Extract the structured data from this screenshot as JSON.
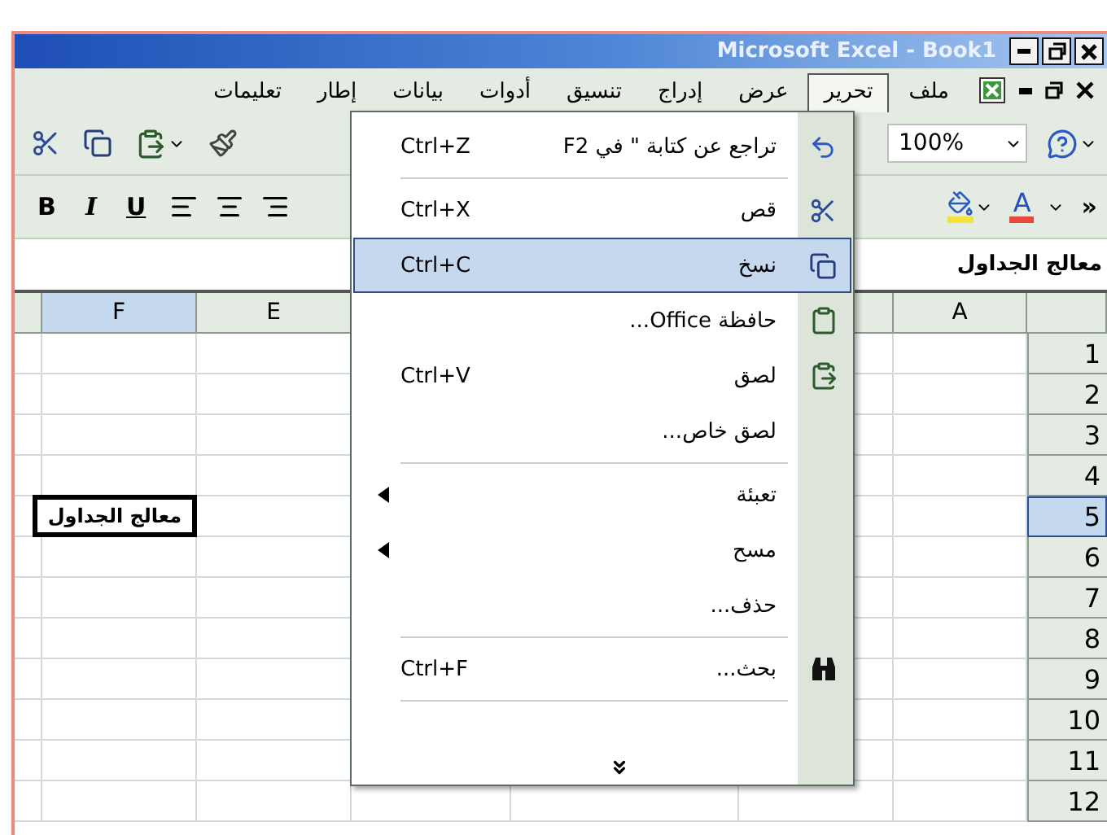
{
  "window": {
    "title": "Microsoft Excel - Book1"
  },
  "menu_bar": {
    "items": [
      {
        "label": "ملف",
        "selected": false
      },
      {
        "label": "تحرير",
        "selected": true
      },
      {
        "label": "عرض",
        "selected": false
      },
      {
        "label": "إدراج",
        "selected": false
      },
      {
        "label": "تنسيق",
        "selected": false
      },
      {
        "label": "أدوات",
        "selected": false
      },
      {
        "label": "بيانات",
        "selected": false
      },
      {
        "label": "إطار",
        "selected": false
      },
      {
        "label": "تعليمات",
        "selected": false
      }
    ]
  },
  "standard_toolbar": {
    "zoom": "100%"
  },
  "formatting_toolbar": {
    "format_buttons": [
      {
        "kind": "underline",
        "label": "U"
      },
      {
        "kind": "italic",
        "label": "I"
      },
      {
        "kind": "bold",
        "label": "B"
      }
    ],
    "font_color": "A",
    "overflow": "»"
  },
  "formula_bar": {
    "value": "معالج الجداول"
  },
  "sheet": {
    "columns": [
      {
        "label": "A",
        "selected": false
      },
      {
        "label": "E",
        "selected": false
      },
      {
        "label": "F",
        "selected": true
      }
    ],
    "rows": [
      {
        "number": "1",
        "selected": false
      },
      {
        "number": "2",
        "selected": false
      },
      {
        "number": "3",
        "selected": false
      },
      {
        "number": "4",
        "selected": false
      },
      {
        "number": "5",
        "selected": true,
        "column_f": "معالج الجداول"
      },
      {
        "number": "6",
        "selected": false
      },
      {
        "number": "7",
        "selected": false
      },
      {
        "number": "8",
        "selected": false
      },
      {
        "number": "9",
        "selected": false
      },
      {
        "number": "10",
        "selected": false
      },
      {
        "number": "11",
        "selected": false
      },
      {
        "number": "12",
        "selected": false
      }
    ]
  },
  "edit_menu": {
    "groups": [
      [
        {
          "kind": "undo",
          "label": "تراجع عن كتابة \" في F2",
          "shortcut": "Ctrl+Z",
          "selected": false,
          "submenu": false
        }
      ],
      [
        {
          "kind": "cut",
          "label": "قص",
          "shortcut": "Ctrl+X",
          "selected": false,
          "submenu": false
        },
        {
          "kind": "copy",
          "label": "نسخ",
          "shortcut": "Ctrl+C",
          "selected": true,
          "submenu": false
        },
        {
          "kind": "clipboard",
          "label": "حافظة Office...",
          "selected": false,
          "submenu": false
        },
        {
          "kind": "paste",
          "label": "لصق",
          "shortcut": "Ctrl+V",
          "selected": false,
          "submenu": false
        },
        {
          "kind": "plain",
          "label": "لصق خاص...",
          "selected": false,
          "submenu": false
        }
      ],
      [
        {
          "kind": "plain",
          "label": "تعبئة",
          "selected": false,
          "submenu": true
        },
        {
          "kind": "plain",
          "label": "مسح",
          "selected": false,
          "submenu": true
        },
        {
          "kind": "plain",
          "label": "حذف...",
          "selected": false,
          "submenu": false
        }
      ],
      [
        {
          "kind": "find",
          "label": "بحث...",
          "shortcut": "Ctrl+F",
          "selected": false,
          "submenu": false
        }
      ]
    ]
  }
}
